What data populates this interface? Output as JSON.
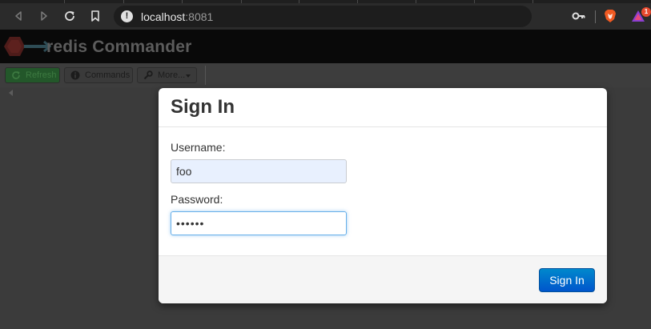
{
  "browser": {
    "url_host": "localhost",
    "url_port": ":8081",
    "rewards_badge_count": "1",
    "icons": {
      "back": "back-arrow-icon",
      "forward": "forward-arrow-icon",
      "reload": "reload-icon",
      "bookmark": "bookmark-icon",
      "site_info": "info-icon",
      "key": "key-icon",
      "brave": "brave-lion-icon",
      "rewards": "brave-rewards-icon"
    }
  },
  "app": {
    "title": "redis Commander",
    "toolbar": {
      "refresh_label": "Refresh",
      "commands_label": "Commands",
      "more_label": "More..."
    }
  },
  "dialog": {
    "title": "Sign In",
    "username_label": "Username:",
    "username_value": "foo",
    "password_label": "Password:",
    "password_value": "••••••",
    "submit_label": "Sign In"
  },
  "colors": {
    "primary_button": "#0066cc",
    "focus_ring": "#66afe9",
    "autofill_bg": "#e8f0fe",
    "refresh_button": "#23572a"
  }
}
